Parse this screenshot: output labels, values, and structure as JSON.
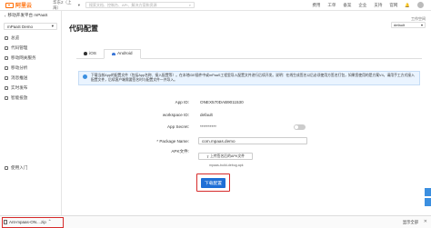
{
  "topbar": {
    "brand": "阿里云",
    "region": "华东2（上海）",
    "search_placeholder": "搜索文档、控制台、API、解决方案和资源",
    "links": [
      "费用",
      "工单",
      "备案",
      "企业",
      "支持",
      "官网"
    ]
  },
  "sidebar": {
    "product": "移动开发平台 mPaaS",
    "app_select": "mPaaS Demo",
    "items": [
      "总览",
      "代码管理",
      "移动网关服务",
      "移动分析",
      "消息推送",
      "实时发布",
      "智能投放"
    ],
    "bottom_item": "使用入门"
  },
  "main": {
    "title": "代码配置",
    "workspace_label": "工作空间",
    "workspace_value": "default",
    "tabs": [
      {
        "label": "iOS",
        "active": false
      },
      {
        "label": "Android",
        "active": true
      }
    ],
    "notice": "下载当前App的配置文件（包括App名称、接入配置等）。在本地IDE插件中或mPaaS工程里导入配置文件进行后续开发。说明：在线生成签名以后必须使用方签名打包，如果您使用的是方案V4，请用手工方式接入配置文件，后续客户端需要签名时与配置文件一并导入。",
    "fields": {
      "app_id_label": "App ID:",
      "app_id_value": "ONEX570DAB9011530",
      "workspace_id_label": "workspace ID:",
      "workspace_id_value": "default",
      "app_secret_label": "App Secret:",
      "app_secret_value": "**********",
      "package_label": "* Package Name:",
      "package_value": "com.mpaas.demo",
      "apk_label": "APK文件:",
      "upload_label": "上传签名后的APK文件",
      "apk_filename": "mpaas-build-debug.apk"
    },
    "submit_label": "下载配置"
  },
  "download_bar": {
    "file": "Ant-mpaas-ON....zip",
    "show_all": "显示全部"
  }
}
